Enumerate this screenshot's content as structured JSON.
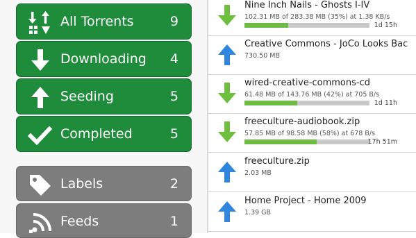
{
  "sidebar": {
    "filters": [
      {
        "label": "All Torrents",
        "count": "9",
        "icon": "all-torrents-icon"
      },
      {
        "label": "Downloading",
        "count": "4",
        "icon": "arrow-down-icon"
      },
      {
        "label": "Seeding",
        "count": "5",
        "icon": "arrow-up-icon"
      },
      {
        "label": "Completed",
        "count": "5",
        "icon": "checkmark-icon"
      }
    ],
    "groups": [
      {
        "label": "Labels",
        "count": "2",
        "icon": "label-tag-icon"
      },
      {
        "label": "Feeds",
        "count": "1",
        "icon": "rss-feed-icon"
      }
    ]
  },
  "torrents": [
    {
      "name": "Nine Inch Nails - Ghosts I-IV",
      "size": "102.31 MB of 283.38 MB (35%) at 1.38 KB/s",
      "eta": "1d 15h",
      "direction": "down",
      "progress": 0.35
    },
    {
      "name": "Creative Commons - JoCo Looks Bac",
      "size": "730.50 MB",
      "eta": "",
      "direction": "up",
      "progress": null
    },
    {
      "name": "wired-creative-commons-cd",
      "size": "61.48 MB of 143.76 MB (42%) at 705 B/s",
      "eta": "1d 11h",
      "direction": "down",
      "progress": 0.42
    },
    {
      "name": "freeculture-audiobook.zip",
      "size": "57.85 MB of 98.58 MB (58%) at 678 B/s",
      "eta": "17h 51m",
      "direction": "down",
      "progress": 0.58
    },
    {
      "name": "freeculture.zip",
      "size": "2.03 MB",
      "eta": "",
      "direction": "up",
      "progress": null
    },
    {
      "name": "Home Project - Home 2009",
      "size": "1.39 GB",
      "eta": "",
      "direction": "up",
      "progress": null
    }
  ],
  "colors": {
    "filter_button": "#1e8c3a",
    "group_button": "#7d7d7d",
    "download_icon": "#6fbf3f",
    "upload_icon": "#2e86de",
    "progress_fill": "#6dbd45",
    "progress_track": "#c9c9c9"
  }
}
